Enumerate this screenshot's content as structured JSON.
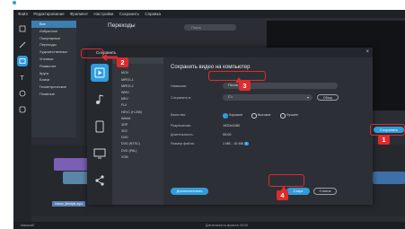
{
  "menubar": [
    "Файл",
    "Редактирование",
    "Фрагмент",
    "Настройки",
    "Сохранить",
    "Справка"
  ],
  "categories": {
    "items": [
      "Все",
      "Избранное",
      "Популярные",
      "Переходы",
      "Художественные",
      "Угловые",
      "Размытие",
      "Круги",
      "Блики",
      "Геометрические",
      "Плавные"
    ],
    "selected_index": 0
  },
  "transitions": {
    "title": "Переходы",
    "search_placeholder": "Поиск"
  },
  "main_save_button": "Сохранить",
  "timeline": {
    "clip_label": "indoor_lifestyle.mp4"
  },
  "statusbar": {
    "zoom_label": "Масштаб",
    "project_info": "Длительность проекта: 00:00"
  },
  "dialog": {
    "title": "Сохранить",
    "close_glyph": "×",
    "heading": "Сохранить видео на компьютер",
    "formats": [
      "MP4",
      "AVI",
      "MOV",
      "MPEG-1",
      "MPEG-2",
      "WMV",
      "MKV",
      "FLV",
      "HEVC (H.265)",
      "WebM",
      "3GP",
      "3G2",
      "DVD",
      "DVD (NTSC)",
      "DVD (PAL)",
      "VOB"
    ],
    "selected_format_index": 0,
    "name_label": "Название:",
    "name_value": "Песня матери",
    "save_to_label": "Сохранить в:",
    "save_to_value": "C:\\",
    "browse_button": "Обзор",
    "quality_label": "Качество:",
    "quality_options": [
      "Хорошее",
      "Высокое",
      "Лучшее"
    ],
    "quality_selected_index": 0,
    "resolution_label": "Разрешение:",
    "resolution_value": "1920x1080",
    "duration_label": "Длительность:",
    "duration_value": "00:00",
    "filesize_label": "Размер файла:",
    "filesize_value": "1 МБ - 10 МБ",
    "advanced_button": "Дополнительно",
    "start_button": "Старт",
    "cancel_button": "Отмена"
  },
  "annotations": {
    "badges": [
      "1",
      "2",
      "3",
      "4"
    ],
    "color": "#e02b2b"
  },
  "colors": {
    "accent": "#2f9ddc",
    "background": "#2a2d33",
    "dialog": "#2c3036"
  }
}
